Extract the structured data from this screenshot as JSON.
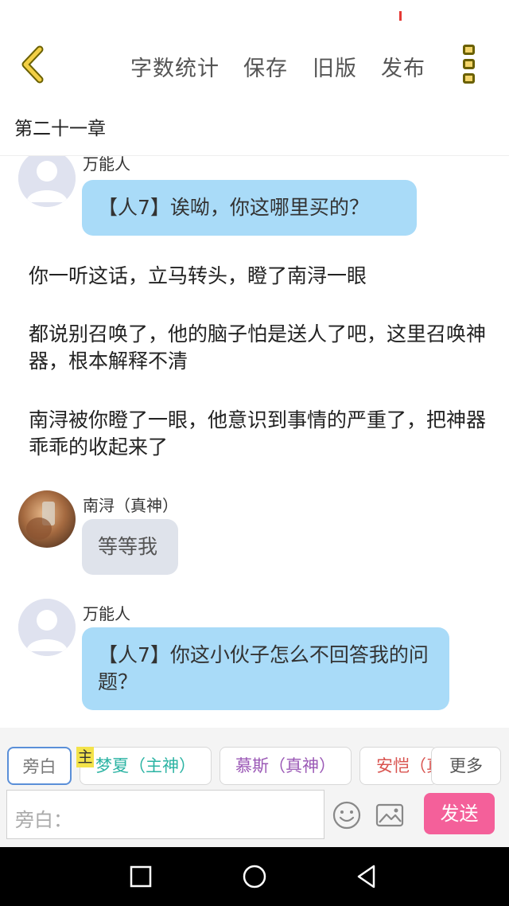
{
  "toolbar": {
    "word_count": "字数统计",
    "save": "保存",
    "old_version": "旧版",
    "publish": "发布"
  },
  "chapter": {
    "title": "第二十一章"
  },
  "messages": [
    {
      "speaker": "万能人",
      "text": "【人7】诶呦，你这哪里买的？"
    },
    {
      "speaker": "南浔（真神）",
      "text": "等等我"
    },
    {
      "speaker": "万能人",
      "text": "【人7】你这小伙子怎么不回答我的问题？"
    }
  ],
  "narration": [
    "你一听这话，立马转头，瞪了南浔一眼",
    "都说别召唤了，他的脑子怕是送人了吧，这里召唤神器，根本解释不清",
    "南浔被你瞪了一眼，他意识到事情的严重了，把神器乖乖的收起来了"
  ],
  "roles": [
    {
      "label": "旁白",
      "color": "#777777"
    },
    {
      "label": "梦夏（主神）",
      "color": "#2bb3a3",
      "tag": "主"
    },
    {
      "label": "慕斯（真神）",
      "color": "#9b59b6"
    },
    {
      "label": "安恺（真神）",
      "color": "#d9534f"
    },
    {
      "label": "更多",
      "color": "#555555"
    }
  ],
  "composer": {
    "placeholder": "旁白：",
    "send": "发送"
  },
  "icons": {
    "back": "chevron-left-icon",
    "menu": "more-vertical-icon",
    "emoji": "smiley-icon",
    "image": "image-icon"
  },
  "colors": {
    "accent": "#f4609a",
    "bubble_blue": "#a9dbf8",
    "bubble_grey": "#dfe3eb",
    "back_icon": "#f2cf45"
  }
}
